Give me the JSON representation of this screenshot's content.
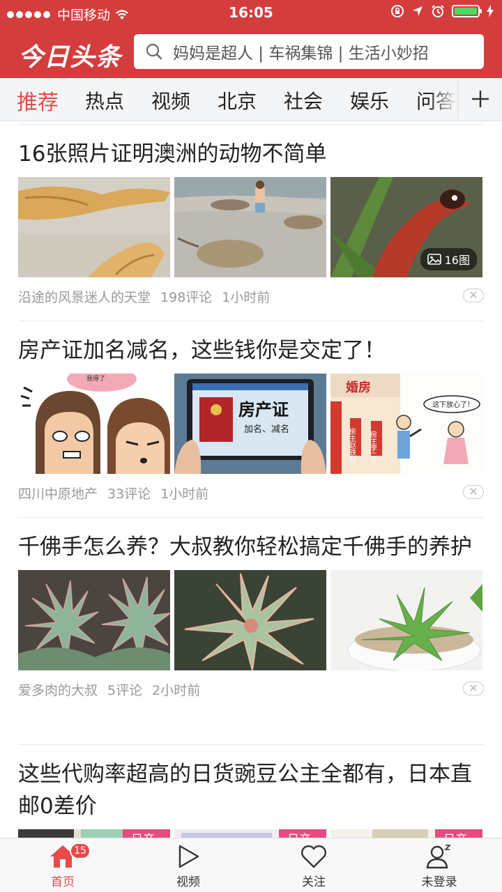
{
  "status_bar": {
    "carrier": "中国移动",
    "time": "16:05"
  },
  "header": {
    "logo": "今日头条",
    "search_placeholder": "妈妈是超人 | 车祸集锦 | 生活小妙招"
  },
  "tabs": [
    "推荐",
    "热点",
    "视频",
    "北京",
    "社会",
    "娱乐",
    "问答"
  ],
  "active_tab": "推荐",
  "articles": [
    {
      "title": "16张照片证明澳洲的动物不简单",
      "source": "沿途的风景迷人的天堂",
      "comments": "198评论",
      "time": "1小时前",
      "image_count": "16图"
    },
    {
      "title": "房产证加名减名，这些钱你是交定了！",
      "source": "四川中原地产",
      "comments": "33评论",
      "time": "1小时前",
      "image_texts": {
        "bubble": "我得了",
        "cert_title": "房产证",
        "cert_sub": "加名、减名",
        "house_label": "婚房",
        "cartoon_bubble": "这下放心了！",
        "name_tag_1": "房主赵铁柱",
        "name_tag_2": "房主李二丫"
      }
    },
    {
      "title": "千佛手怎么养？大叔教你轻松搞定千佛手的养护",
      "source": "爱多肉的大叔",
      "comments": "5评论",
      "time": "2小时前"
    },
    {
      "title": "这些代购率超高的日货豌豆公主全都有，日本直邮0差价",
      "image_tag": "日产"
    }
  ],
  "tab_bar": {
    "items": [
      "首页",
      "视频",
      "关注",
      "未登录"
    ],
    "home_badge": "15"
  },
  "colors": {
    "brand_red": "#d43d3d",
    "active_red": "#e84a4a"
  }
}
